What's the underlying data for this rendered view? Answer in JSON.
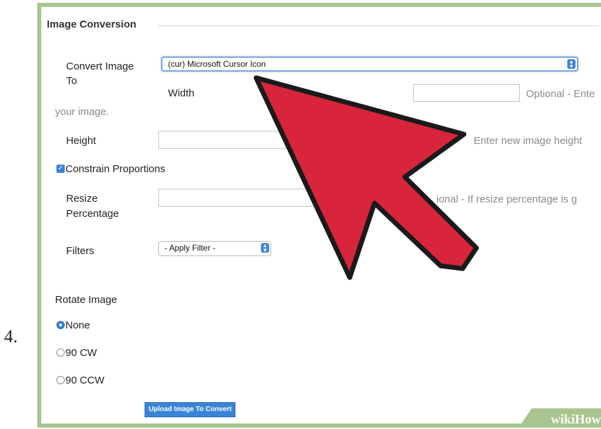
{
  "step_number": "4.",
  "section": {
    "title": "Image Conversion"
  },
  "convert": {
    "label_line1": "Convert Image",
    "label_line2": "To",
    "selected": "(cur) Microsoft Cursor Icon"
  },
  "width": {
    "label": "Width",
    "hint": "Optional - Ente",
    "hint_wrap": "your image."
  },
  "height": {
    "label": "Height",
    "hint": "Enter new image height"
  },
  "constrain": {
    "label": "Constrain Proportions",
    "checked": true
  },
  "resize": {
    "label_line1": "Resize",
    "label_line2": "Percentage",
    "hint": "ional - If resize percentage is g"
  },
  "filters": {
    "label": "Filters",
    "selected": "- Apply Filter -"
  },
  "rotate": {
    "label": "Rotate Image",
    "options": [
      {
        "label": "None",
        "selected": true
      },
      {
        "label": "90 CW",
        "selected": false
      },
      {
        "label": "90 CCW",
        "selected": false
      }
    ]
  },
  "upload_button": {
    "label": "Upload Image To Convert"
  },
  "watermark": {
    "part1": "wiki",
    "part2": "How"
  },
  "colors": {
    "arrow_fill": "#d9253c",
    "arrow_stroke": "#1a1a1a",
    "frame": "#a9c58f",
    "accent": "#3a84d6"
  }
}
